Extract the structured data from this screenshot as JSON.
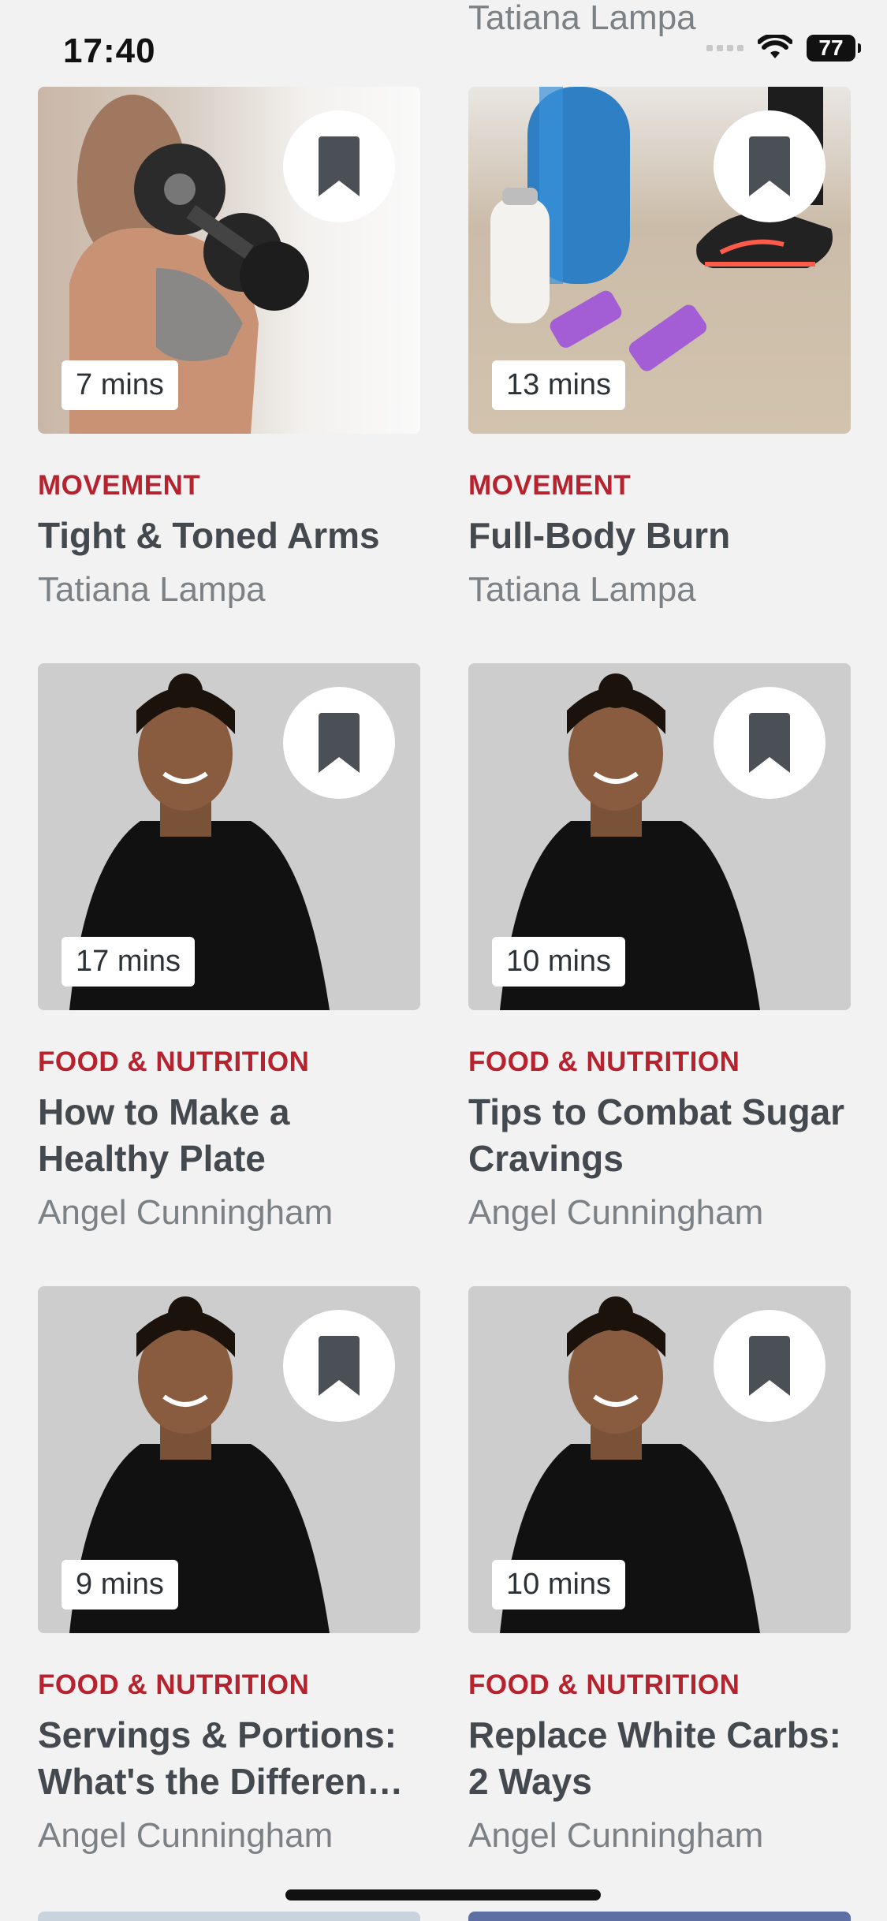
{
  "status": {
    "time": "17:40",
    "battery": "77"
  },
  "top_partial_author": "Tatiana Lampa",
  "cards": [
    {
      "duration": "7 mins",
      "category": "MOVEMENT",
      "title": "Tight & Toned Arms",
      "author": "Tatiana Lampa",
      "image": "woman-dumbbell"
    },
    {
      "duration": "13 mins",
      "category": "MOVEMENT",
      "title": "Full-Body Burn",
      "author": "Tatiana Lampa",
      "image": "yoga-mat-dumbbells"
    },
    {
      "duration": "17 mins",
      "category": "FOOD & NUTRITION",
      "title": "How to Make a Healthy Plate",
      "author": "Angel Cunningham",
      "image": "coach-portrait"
    },
    {
      "duration": "10 mins",
      "category": "FOOD & NUTRITION",
      "title": "Tips to Combat Sugar Cravings",
      "author": "Angel Cunningham",
      "image": "coach-portrait"
    },
    {
      "duration": "9 mins",
      "category": "FOOD & NUTRITION",
      "title": "Servings & Portions: What's the Differen…",
      "author": "Angel Cunningham",
      "image": "coach-portrait"
    },
    {
      "duration": "10 mins",
      "category": "FOOD & NUTRITION",
      "title": "Replace White Carbs: 2 Ways",
      "author": "Angel Cunningham",
      "image": "coach-portrait"
    }
  ],
  "colors": {
    "accent": "#b6222d",
    "text": "#43494e",
    "muted": "#7c8186",
    "background": "#f2f2f3"
  },
  "icons": {
    "bookmark": "bookmark-icon"
  }
}
